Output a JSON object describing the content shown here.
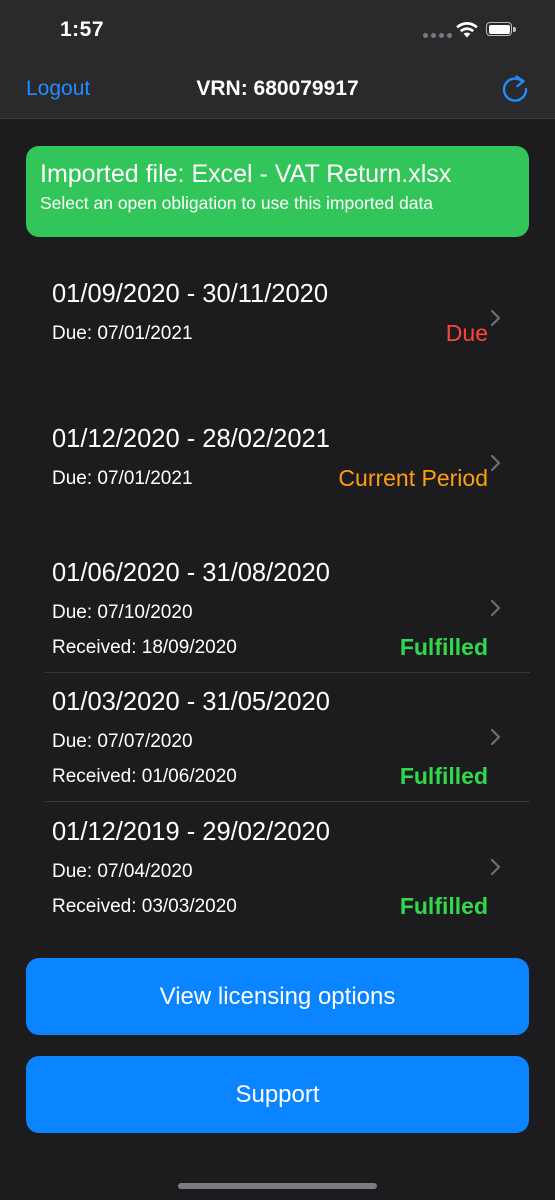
{
  "status_bar": {
    "time": "1:57"
  },
  "nav": {
    "left_button": "Logout",
    "title": "VRN: 680079917",
    "right_icon": "refresh-icon"
  },
  "banner": {
    "title": "Imported file: Excel - VAT Return.xlsx",
    "subtitle": "Select an open obligation to use this imported data"
  },
  "obligations": [
    {
      "period": "01/09/2020 - 30/11/2020",
      "due": "Due: 07/01/2021",
      "received": "",
      "status": "Due",
      "status_color": "#ff453a"
    },
    {
      "period": "01/12/2020 - 28/02/2021",
      "due": "Due: 07/01/2021",
      "received": "",
      "status": "Current Period",
      "status_color": "#ff9f0a"
    },
    {
      "period": "01/06/2020 - 31/08/2020",
      "due": "Due: 07/10/2020",
      "received": "Received: 18/09/2020",
      "status": "Fulfilled",
      "status_color": "#32d74b"
    },
    {
      "period": "01/03/2020 - 31/05/2020",
      "due": "Due: 07/07/2020",
      "received": "Received: 01/06/2020",
      "status": "Fulfilled",
      "status_color": "#32d74b"
    },
    {
      "period": "01/12/2019 - 29/02/2020",
      "due": "Due: 07/04/2020",
      "received": "Received: 03/03/2020",
      "status": "Fulfilled",
      "status_color": "#32d74b"
    }
  ],
  "buttons": {
    "licensing": "View licensing options",
    "support": "Support"
  },
  "colors": {
    "accent": "#0a84ff",
    "banner": "#32c559",
    "background": "#1c1c1e"
  }
}
